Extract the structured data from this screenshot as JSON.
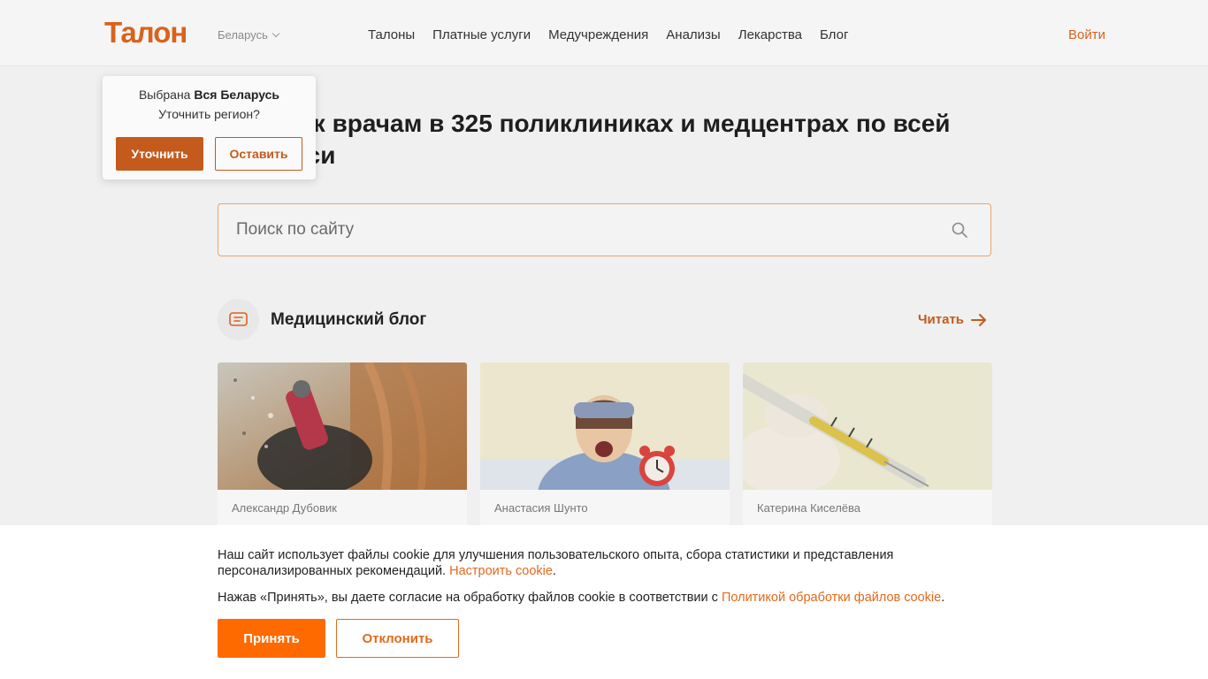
{
  "header": {
    "logo": "Талон",
    "region": "Беларусь",
    "nav": [
      "Талоны",
      "Платные услуги",
      "Медучреждения",
      "Анализы",
      "Лекарства",
      "Блог"
    ],
    "login": "Войти"
  },
  "hero": {
    "title": "Запись к врачам в 325 поликлиниках и медцентрах по всей Беларуси"
  },
  "search": {
    "placeholder": "Поиск по сайту",
    "icon": "search-icon"
  },
  "blog": {
    "title": "Медицинский блог",
    "read_label": "Читать",
    "cards": [
      {
        "author": "Александр Дубовик"
      },
      {
        "author": "Анастасия Шунто"
      },
      {
        "author": "Катерина Киселёва"
      }
    ]
  },
  "region_popup": {
    "selected_prefix": "Выбрана",
    "selected_value": "Вся Беларусь",
    "question": "Уточнить регион?",
    "clarify_label": "Уточнить",
    "keep_label": "Оставить"
  },
  "cookie": {
    "text1": "Наш сайт использует файлы cookie для улучшения пользовательского опыта, сбора статистики и представления персонализированных рекомендаций.",
    "settings_link": "Настроить cookie",
    "text2": "Нажав «Принять», вы даете согласие на обработку файлов cookie в соответствии с",
    "policy_link": "Политикой обработки файлов cookie",
    "accept_label": "Принять",
    "decline_label": "Отклонить"
  },
  "colors": {
    "brand": "#ff6a00",
    "brand_dim": "#c45a1c"
  }
}
